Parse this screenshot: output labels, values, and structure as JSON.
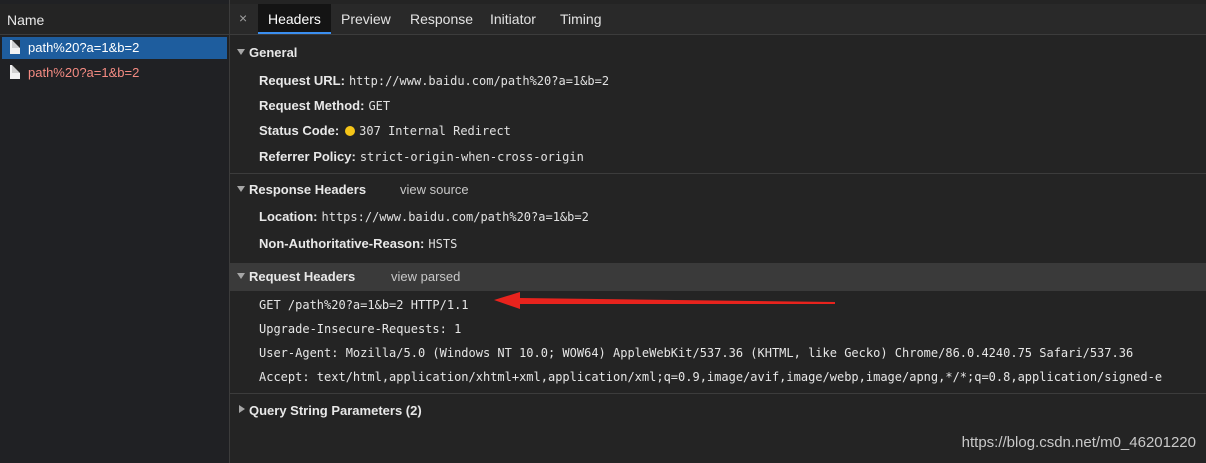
{
  "list": {
    "header": "Name",
    "requests": [
      {
        "name": "path%20?a=1&b=2",
        "state": "selected"
      },
      {
        "name": "path%20?a=1&b=2",
        "state": "error"
      }
    ]
  },
  "tabs": {
    "close": "×",
    "items": [
      "Headers",
      "Preview",
      "Response",
      "Initiator",
      "Timing"
    ],
    "active": "Headers"
  },
  "general": {
    "title": "General",
    "request_url_label": "Request URL:",
    "request_url": "http://www.baidu.com/path%20?a=1&b=2",
    "request_method_label": "Request Method:",
    "request_method": "GET",
    "status_code_label": "Status Code:",
    "status_code": "307 Internal Redirect",
    "status_color": "#f5c518",
    "referrer_policy_label": "Referrer Policy:",
    "referrer_policy": "strict-origin-when-cross-origin"
  },
  "response_headers": {
    "title": "Response Headers",
    "link": "view source",
    "location_label": "Location:",
    "location": "https://www.baidu.com/path%20?a=1&b=2",
    "non_auth_label": "Non-Authoritative-Reason:",
    "non_auth": "HSTS"
  },
  "request_headers": {
    "title": "Request Headers",
    "link": "view parsed",
    "lines": [
      "GET /path%20?a=1&b=2 HTTP/1.1",
      "Upgrade-Insecure-Requests: 1",
      "User-Agent: Mozilla/5.0 (Windows NT 10.0; WOW64) AppleWebKit/537.36 (KHTML, like Gecko) Chrome/86.0.4240.75 Safari/537.36",
      "Accept: text/html,application/xhtml+xml,application/xml;q=0.9,image/avif,image/webp,image/apng,*/*;q=0.8,application/signed-e"
    ]
  },
  "query_string": {
    "title": "Query String Parameters (2)"
  },
  "watermark": "https://blog.csdn.net/m0_46201220",
  "colors": {
    "selected_row": "#1e5d9e",
    "error_text": "#f48b82",
    "annotation_arrow": "#e8231d"
  }
}
